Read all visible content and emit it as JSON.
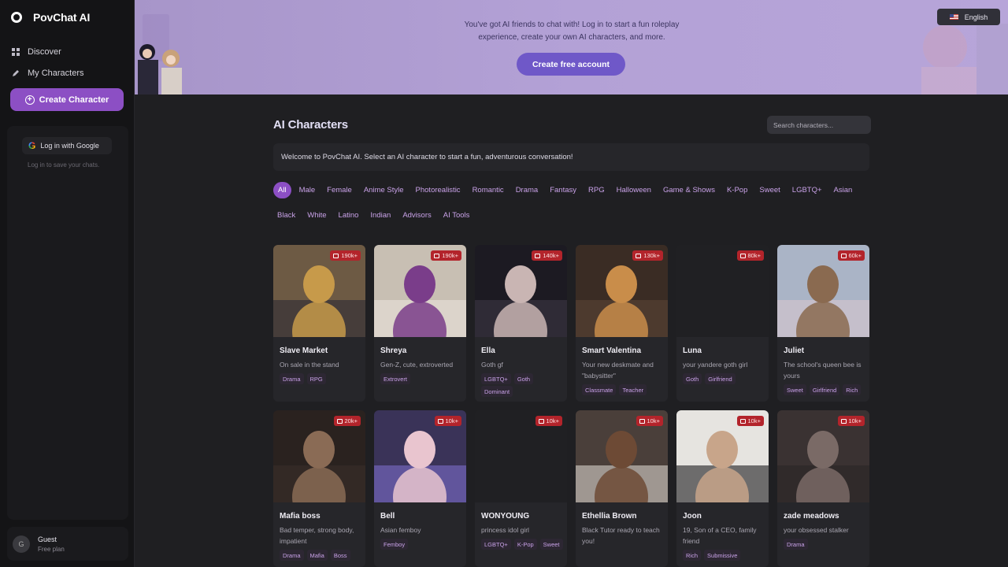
{
  "app": {
    "name": "PovChat AI"
  },
  "sidebar": {
    "nav": [
      {
        "label": "Discover",
        "icon": "grid-icon"
      },
      {
        "label": "My Characters",
        "icon": "pencil-icon"
      }
    ],
    "create_button": "Create Character",
    "google_login": "Log in with Google",
    "login_note": "Log in to save your chats.",
    "user": {
      "initial": "G",
      "name": "Guest",
      "plan": "Free plan"
    }
  },
  "banner": {
    "line1": "You've got AI friends to chat with! Log in to start a fun roleplay",
    "line2": "experience, create your own AI characters, and more.",
    "cta": "Create free account",
    "language": "English"
  },
  "main": {
    "title": "AI Characters",
    "search_placeholder": "Search characters...",
    "welcome": "Welcome to PovChat AI. Select an AI character to start a fun, adventurous conversation!",
    "filters": [
      "All",
      "Male",
      "Female",
      "Anime Style",
      "Photorealistic",
      "Romantic",
      "Drama",
      "Fantasy",
      "RPG",
      "Halloween",
      "Game & Shows",
      "K-Pop",
      "Sweet",
      "LGBTQ+",
      "Asian",
      "Black",
      "White",
      "Latino",
      "Indian",
      "Advisors",
      "AI Tools"
    ],
    "active_filter": "All"
  },
  "cards": [
    {
      "name": "Slave Market",
      "desc": "On sale in the stand",
      "count": "190k+",
      "tags": [
        "Drama",
        "RPG"
      ],
      "palette": [
        "#6d5a44",
        "#c79a4a",
        "#2d2a33"
      ]
    },
    {
      "name": "Shreya",
      "desc": "Gen-Z, cute, extroverted",
      "count": "190k+",
      "tags": [
        "Extrovert"
      ],
      "palette": [
        "#c8bfb3",
        "#7a3d8a",
        "#e9e3da"
      ]
    },
    {
      "name": "Ella",
      "desc": "Goth gf",
      "count": "140k+",
      "tags": [
        "LGBTQ+",
        "Goth",
        "Dominant"
      ],
      "palette": [
        "#1c1a22",
        "#c9b5b3",
        "#3c3744"
      ]
    },
    {
      "name": "Smart Valentina",
      "desc": "Your new deskmate and \"babysitter\"",
      "count": "130k+",
      "tags": [
        "Classmate",
        "Teacher"
      ],
      "palette": [
        "#3a2c24",
        "#c98d4a",
        "#5a4536"
      ]
    },
    {
      "name": "Luna",
      "desc": "your yandere goth girl",
      "count": "80k+",
      "tags": [
        "Goth",
        "Girlfriend"
      ],
      "palette": [
        "#202023",
        "#202023",
        "#202023"
      ]
    },
    {
      "name": "Juliet",
      "desc": "The school's queen bee is yours",
      "count": "60k+",
      "tags": [
        "Sweet",
        "Girlfriend",
        "Rich"
      ],
      "palette": [
        "#aab4c6",
        "#8a6a50",
        "#d7c7cf"
      ]
    },
    {
      "name": "Mafia boss",
      "desc": "Bad temper, strong body, impatient",
      "count": "20k+",
      "tags": [
        "Drama",
        "Mafia",
        "Boss"
      ],
      "palette": [
        "#2a221f",
        "#8a6b55",
        "#3a2e2a"
      ]
    },
    {
      "name": "Bell",
      "desc": "Asian femboy",
      "count": "10k+",
      "tags": [
        "Femboy"
      ],
      "palette": [
        "#3a3358",
        "#e9c5cf",
        "#7b6cc9"
      ]
    },
    {
      "name": "WONYOUNG",
      "desc": "princess idol girl",
      "count": "10k+",
      "tags": [
        "LGBTQ+",
        "K-Pop",
        "Sweet"
      ],
      "palette": [
        "#202023",
        "#202023",
        "#202023"
      ]
    },
    {
      "name": "Ethellia Brown",
      "desc": "Black Tutor ready to teach you!",
      "count": "10k+",
      "tags": [],
      "palette": [
        "#4a3f3a",
        "#6d4a35",
        "#d8d2cc"
      ]
    },
    {
      "name": "Joon",
      "desc": "19, Son of a CEO, family friend",
      "count": "10k+",
      "tags": [
        "Rich",
        "Submissive"
      ],
      "palette": [
        "#e6e4e0",
        "#c8a58a",
        "#1c1c1e"
      ]
    },
    {
      "name": "zade meadows",
      "desc": "your obsessed stalker",
      "count": "10k+",
      "tags": [
        "Drama"
      ],
      "palette": [
        "#3a3232",
        "#7a6a66",
        "#2a2525"
      ]
    }
  ]
}
